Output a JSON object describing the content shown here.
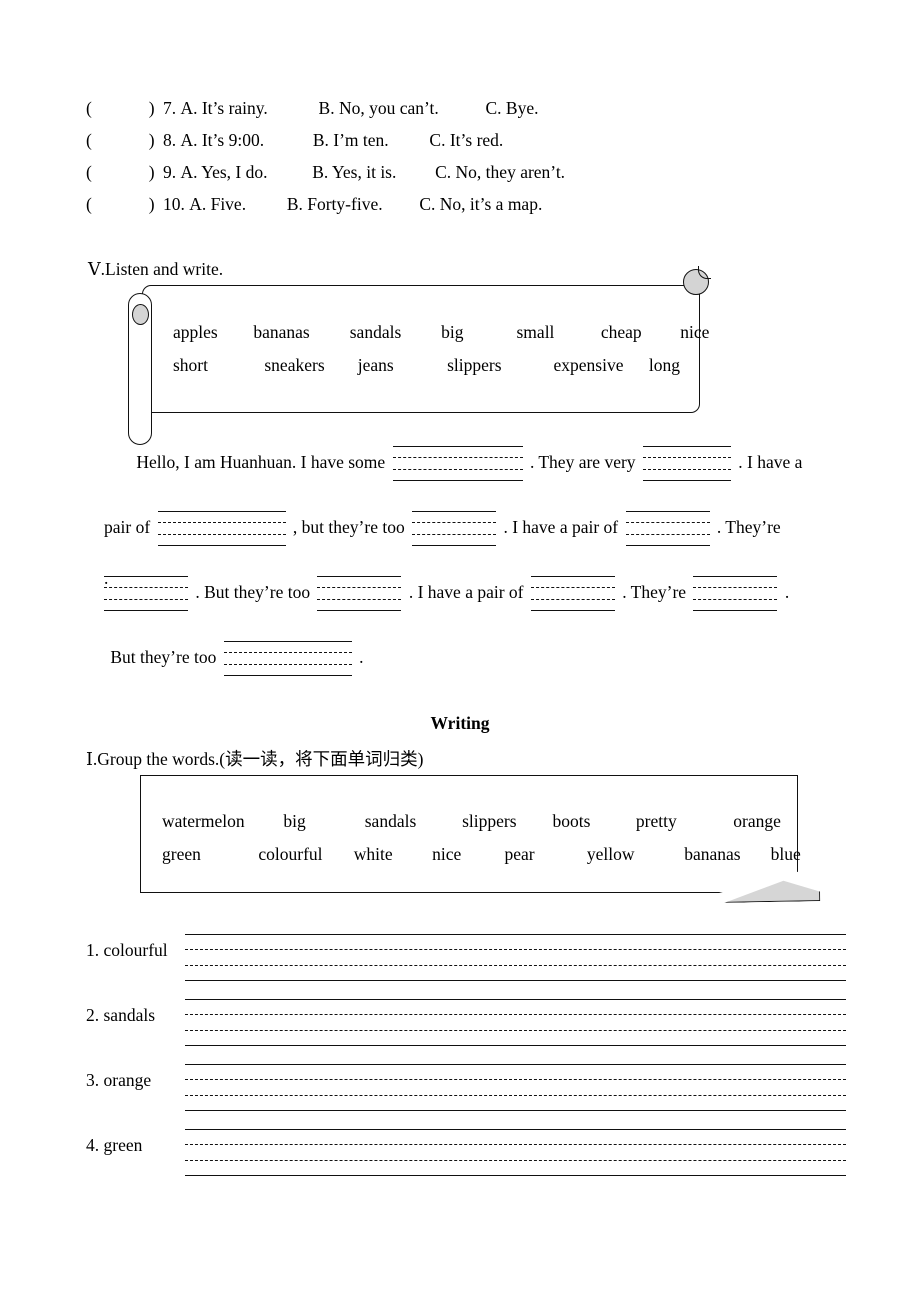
{
  "multiple_choice": [
    {
      "paren_open": "(",
      "paren_close": ")",
      "number": "7.",
      "option_a": "A. It’s rainy.",
      "option_b": "B. No, you can’t.",
      "option_c": "C. Bye."
    },
    {
      "paren_open": "(",
      "paren_close": ")",
      "number": "8.",
      "option_a": "A. It’s 9:00.",
      "option_b": "B. I’m ten.",
      "option_c": "C. It’s red."
    },
    {
      "paren_open": "(",
      "paren_close": ")",
      "number": "9.",
      "option_a": "A. Yes, I do.",
      "option_b": "B. Yes, it is.",
      "option_c": "C. No, they aren’t."
    },
    {
      "paren_open": "(",
      "paren_close": ")",
      "number": "10.",
      "option_a": "A. Five.",
      "option_b": "B. Forty-five.",
      "option_c": "C. No, it’s a map."
    }
  ],
  "listen_section": {
    "heading": "Ⅴ.Listen and write.",
    "word_bank_row1": [
      "apples",
      "bananas",
      "sandals",
      "big",
      "small",
      "cheap",
      "nice"
    ],
    "word_bank_row2": [
      "short",
      "sneakers",
      "jeans",
      "slippers",
      "expensive",
      "long"
    ],
    "paragraph": {
      "line1": {
        "text1": "Hello, I am Huanhuan. I have some",
        "text2": ". They are very",
        "text3": ". I have a"
      },
      "line2": {
        "text1": "pair of",
        "text2": ", but they’re too",
        "text3": ". I have a pair of",
        "text4": ". They’re"
      },
      "line3": {
        "orphan_period": ".",
        "text1": ". But they’re too",
        "text2": ". I have a pair of",
        "text3": ". They’re",
        "text4": "."
      },
      "line4": {
        "text1": "But they’re too",
        "text2": "."
      }
    }
  },
  "writing_section": {
    "title": "Writing",
    "group_heading": "Ⅰ.Group the words.(读一读，将下面单词归类)",
    "word_bank_row1": [
      "watermelon",
      "big",
      "sandals",
      "slippers",
      "boots",
      "pretty",
      "orange"
    ],
    "word_bank_row2": [
      "green",
      "colourful",
      "white",
      "nice",
      "pear",
      "yellow",
      "bananas",
      "blue"
    ],
    "answer_rows": [
      {
        "label": "1. colourful"
      },
      {
        "label": "2. sandals"
      },
      {
        "label": "3. orange"
      },
      {
        "label": "4. green"
      }
    ]
  },
  "colors": {
    "ink": "#000000",
    "paper": "#ffffff",
    "fold_gray": "#d6d6d6",
    "knob_gray": "#d4d4d4"
  }
}
